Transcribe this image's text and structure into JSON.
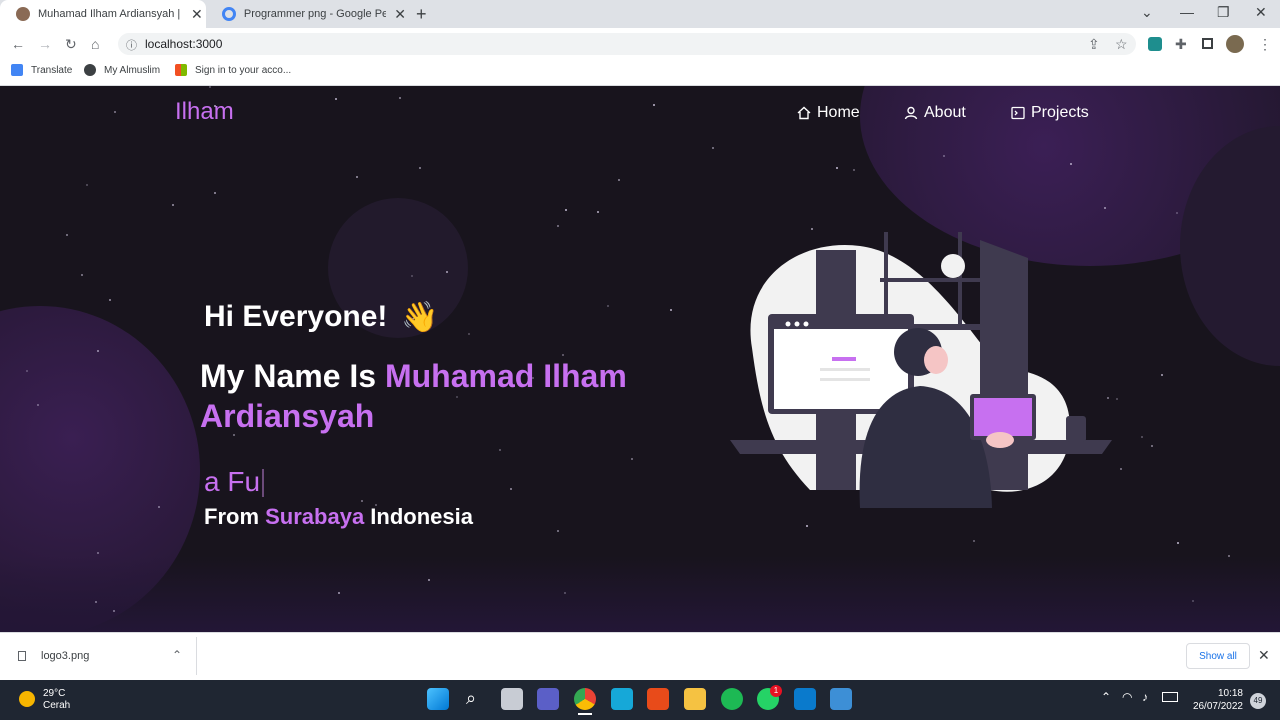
{
  "browser": {
    "tabs": [
      {
        "label": "Muhamad Ilham Ardiansyah | Port",
        "active": true
      },
      {
        "label": "Programmer png - Google Penel",
        "active": false
      }
    ],
    "url": "localhost:3000",
    "bookmarks": [
      "Translate",
      "My Almuslim",
      "Sign in to your acco..."
    ]
  },
  "site": {
    "brand": "Ilham",
    "nav": [
      "Home",
      "About",
      "Projects"
    ],
    "greeting": "Hi Everyone!",
    "wave": "👋",
    "name_prefix": "My Name Is ",
    "name_highlight_1": "Muhamad Ilham",
    "name_highlight_2": "Ardiansyah",
    "typed_text": "a Fu",
    "from_prefix": "From ",
    "from_city": "Surabaya",
    "from_suffix": " Indonesia",
    "accent_color": "#c770f0"
  },
  "downloads": {
    "file": "logo3.png",
    "show_all": "Show all"
  },
  "taskbar": {
    "temperature": "29°C",
    "condition": "Cerah",
    "time": "10:18",
    "date": "26/07/2022",
    "whatsapp_badge": "1",
    "notification_count": "49"
  }
}
